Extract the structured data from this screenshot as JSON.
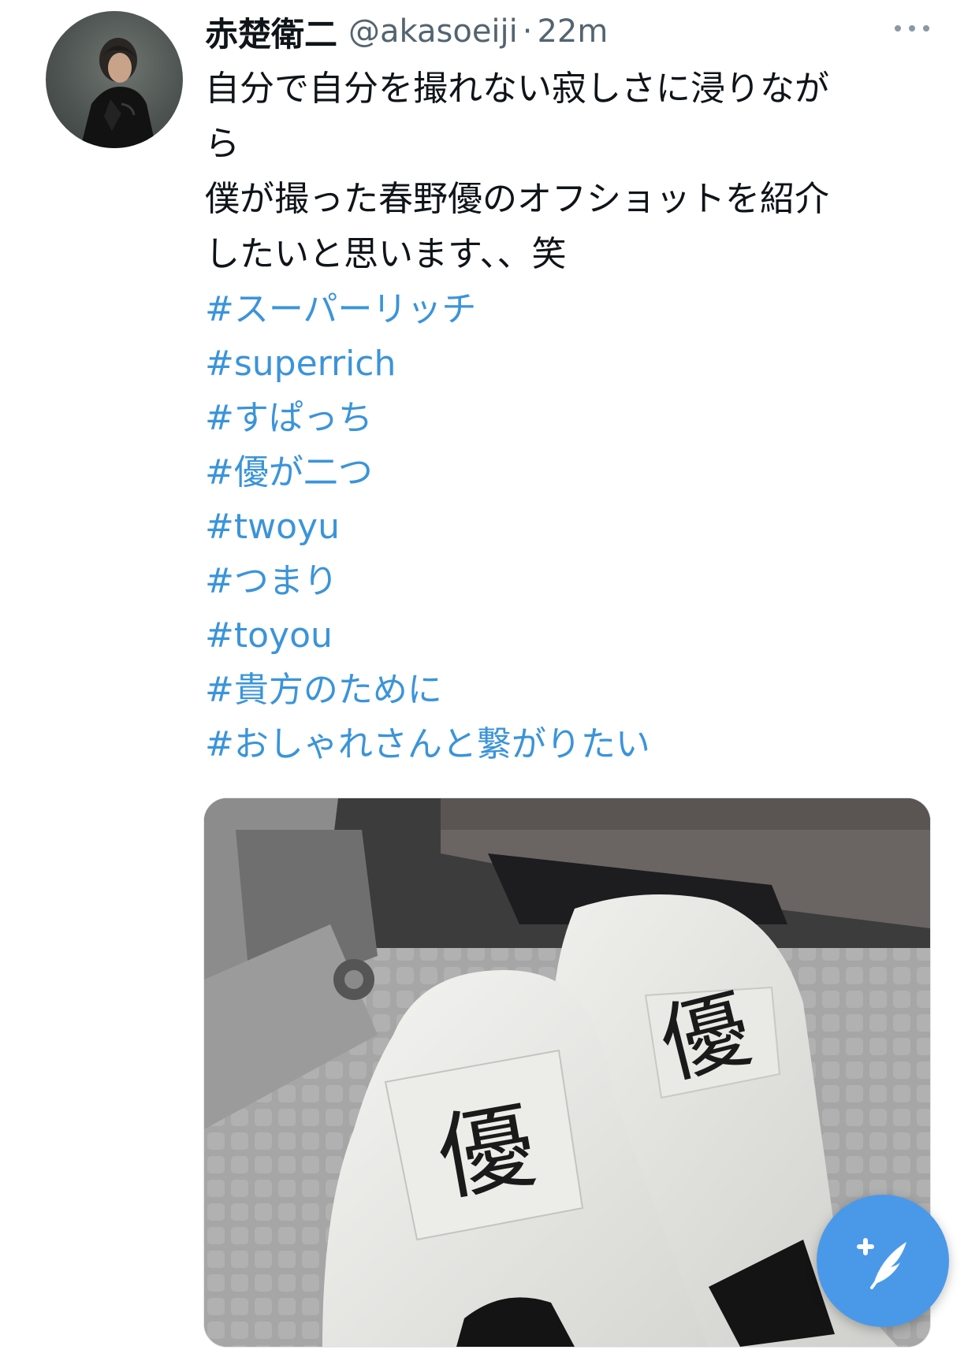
{
  "tweet": {
    "author_name": "赤楚衛二",
    "handle": "@akasoeiji",
    "separator": "·",
    "time": "22m",
    "text_lines": [
      "自分で自分を撮れない寂しさに浸りなが",
      "ら",
      "僕が撮った春野優のオフショットを紹介",
      "したいと思います、、笑"
    ],
    "hashtags": [
      "#スーパーリッチ",
      "#superrich",
      "#すぱっち",
      "#優が二つ",
      "#twoyu",
      "#つまり",
      "#toyou",
      "#貴方のために",
      "#おしゃれさんと繋がりたい"
    ],
    "media_shoe_label": "優"
  },
  "icons": {
    "more": "more-horizontal-icon",
    "compose": "compose-tweet-icon"
  },
  "colors": {
    "hashtag": "#3b94d9",
    "fab": "#4a99e9",
    "secondary_text": "#536471"
  }
}
